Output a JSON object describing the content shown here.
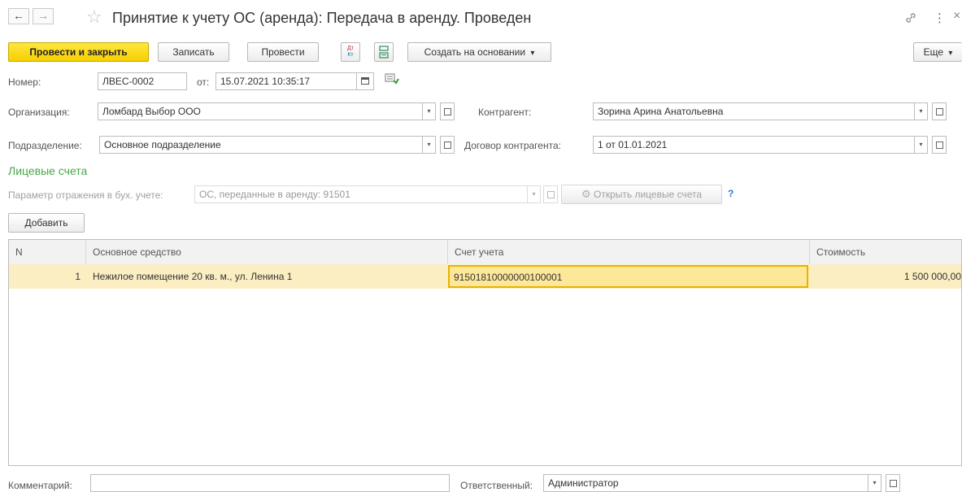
{
  "window": {
    "title": "Принятие к учету ОС (аренда): Передача в аренду. Проведен",
    "back_icon": "←",
    "forward_icon": "→",
    "star_icon": "☆",
    "link_icon": "🔗",
    "more_icon": "⋮",
    "close_icon": "×"
  },
  "toolbar": {
    "post_close": "Провести и закрыть",
    "write": "Записать",
    "post": "Провести",
    "dtkt_top": "Дт",
    "dtkt_bottom": "Кт",
    "create_based": "Создать на основании",
    "more": "Еще",
    "dropdown_arrow": "▾"
  },
  "header": {
    "number_label": "Номер:",
    "number_value": "ЛВЕС-0002",
    "date_label": "от:",
    "date_value": "15.07.2021 10:35:17",
    "org_label": "Организация:",
    "org_value": "Ломбард Выбор ООО",
    "dept_label": "Подразделение:",
    "dept_value": "Основное подразделение",
    "contractor_label": "Контрагент:",
    "contractor_value": "Зорина Арина Анатольевна",
    "contract_label": "Договор контрагента:",
    "contract_value": "1 от 01.01.2021"
  },
  "accounts": {
    "section_title": "Лицевые счета",
    "param_label": "Параметр отражения в бух. учете:",
    "param_value": "ОС, переданные в аренду: 91501",
    "open_button": "Открыть лицевые счета",
    "help": "?"
  },
  "table": {
    "add_button": "Добавить",
    "columns": [
      "N",
      "Основное средство",
      "Счет учета",
      "Стоимость"
    ],
    "rows": [
      {
        "n": "1",
        "asset": "Нежилое помещение 20 кв. м., ул. Ленина 1",
        "account": "91501810000000100001",
        "cost": "1 500 000,00"
      }
    ]
  },
  "footer": {
    "comment_label": "Комментарий:",
    "comment_value": "",
    "responsible_label": "Ответственный:",
    "responsible_value": "Администратор"
  },
  "colors": {
    "primary_button": "#f6cf00",
    "section_green": "#4aa64a",
    "selected_row": "#fbeec2",
    "active_cell_border": "#e8b200"
  }
}
